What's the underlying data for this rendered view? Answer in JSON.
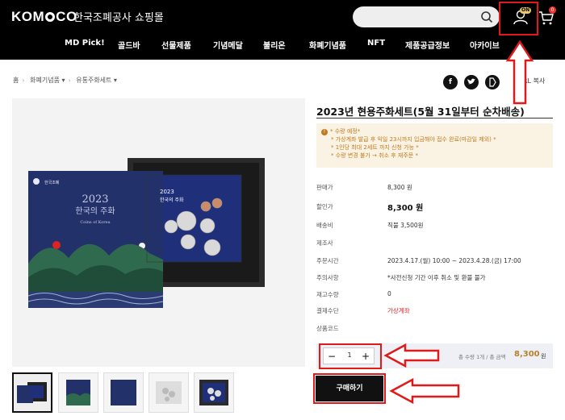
{
  "header": {
    "logo": "KOMSCO",
    "logo_parts": [
      "KOM",
      "CO"
    ],
    "mall_name": "한국조폐공사 쇼핑몰",
    "on_badge": "ON",
    "cart_count": "0",
    "nav": [
      "MD Pick!",
      "골드바",
      "선물제품",
      "기념메달",
      "불리온",
      "화폐기념품",
      "NFT",
      "제품공급정보",
      "아카이브"
    ]
  },
  "breadcrumb": [
    "홈",
    "화폐기념품 ▾",
    "유통주화세트 ▾"
  ],
  "share": {
    "facebook": "f",
    "twitter": "t",
    "url_copy": "RL 복사"
  },
  "product": {
    "title": "2023년 현용주화세트(5월 31일부터 순차배송)",
    "notice": [
      "* 수량 예정*",
      "* 가상계좌 발급 후 익일 23시까지 입금해야 접수 완료(마감일 제외) *",
      "* 1인당 최대 2세트 까지 신청 가능 *",
      "* 수량 변경 불가 → 취소 후 재주문 *"
    ],
    "rows": [
      {
        "label": "판매가",
        "value": "8,300 원"
      },
      {
        "label": "할인가",
        "value": "8,300 원"
      },
      {
        "label": "배송비",
        "value": "직불 3,500원"
      },
      {
        "label": "제조사",
        "value": ""
      },
      {
        "label": "주문시간",
        "value": "2023.4.17.(월) 10:00 ~ 2023.4.28.(금) 17:00"
      },
      {
        "label": "주의사항",
        "value": "*사전신청 기간 이후 취소 및 환불 불가"
      },
      {
        "label": "재고수량",
        "value": "0"
      },
      {
        "label": "결제수단",
        "value": "가상계좌"
      },
      {
        "label": "상품코드",
        "value": ""
      }
    ],
    "quantity": "1",
    "total_label": "총 수량 1개 / 총 금액",
    "total_value": "8,300",
    "total_unit": "원",
    "buy_label": "구매하기",
    "cover": {
      "brand": "한국조폐",
      "year": "2023",
      "title": "한국의 주화",
      "subtitle": "Coins of Korea"
    }
  },
  "colors": {
    "header_bg": "#000000",
    "accent_gold": "#b9812d",
    "annotation_red": "#e0191a",
    "cover_navy": "#23316b"
  }
}
